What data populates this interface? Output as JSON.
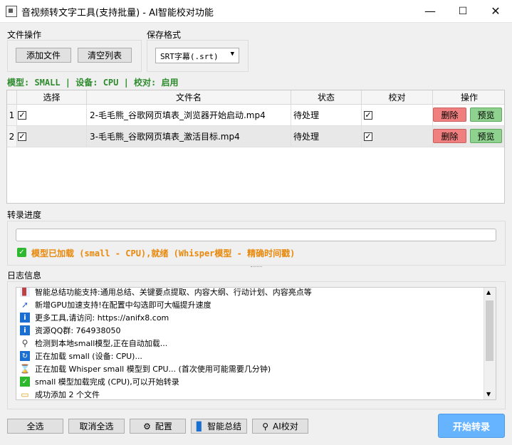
{
  "window": {
    "title": "音视频转文字工具(支持批量) - AI智能校对功能",
    "minimize": "—",
    "maximize": "☐",
    "close": "✕"
  },
  "file_ops": {
    "label": "文件操作",
    "add_label": "添加文件",
    "clear_label": "清空列表"
  },
  "save_format": {
    "label": "保存格式",
    "selected": "SRT字幕(.srt)"
  },
  "status_line": "模型: SMALL | 设备: CPU | 校对: 启用",
  "table": {
    "headers": [
      "选择",
      "文件名",
      "状态",
      "校对",
      "操作"
    ],
    "rows": [
      {
        "num": "1",
        "checked": true,
        "filename": "2-毛毛熊_谷歌网页填表_浏览器开始启动.mp4",
        "status": "待处理",
        "proofread": true,
        "delete": "删除",
        "preview": "预览"
      },
      {
        "num": "2",
        "checked": true,
        "filename": "3-毛毛熊_谷歌网页填表_激活目标.mp4",
        "status": "待处理",
        "proofread": true,
        "delete": "删除",
        "preview": "预览"
      }
    ]
  },
  "progress": {
    "label": "转录进度",
    "value": 0,
    "message": "模型已加载 (small - CPU),就绪 (Whisper模型 - 精确时间戳)"
  },
  "log": {
    "label": "日志信息",
    "lines": [
      {
        "icon": "chart-icon",
        "text": "智能总结功能支持:通用总结、关键要点提取、内容大纲、行动计划、内容亮点等"
      },
      {
        "icon": "rocket-icon",
        "text": "新增GPU加速支持!在配置中勾选即可大幅提升速度"
      },
      {
        "icon": "info-icon",
        "text": "更多工具,请访问: https://anifx8.com"
      },
      {
        "icon": "info-icon",
        "text": "资源QQ群: 764938050"
      },
      {
        "icon": "magnifier-icon",
        "text": "检测到本地small模型,正在自动加载..."
      },
      {
        "icon": "refresh-icon",
        "text": "正在加载 small (设备: CPU)..."
      },
      {
        "icon": "hourglass-icon",
        "text": "正在加载 Whisper small 模型到 CPU... (首次使用可能需要几分钟)"
      },
      {
        "icon": "check-icon",
        "text": "small 模型加载完成 (CPU),可以开始转录"
      },
      {
        "icon": "folder-icon",
        "text": "成功添加 2 个文件"
      }
    ]
  },
  "bottom": {
    "select_all": "全选",
    "deselect_all": "取消全选",
    "config": "配置",
    "summary": "智能总结",
    "ai_proof": "AI校对",
    "start": "开始转录"
  }
}
